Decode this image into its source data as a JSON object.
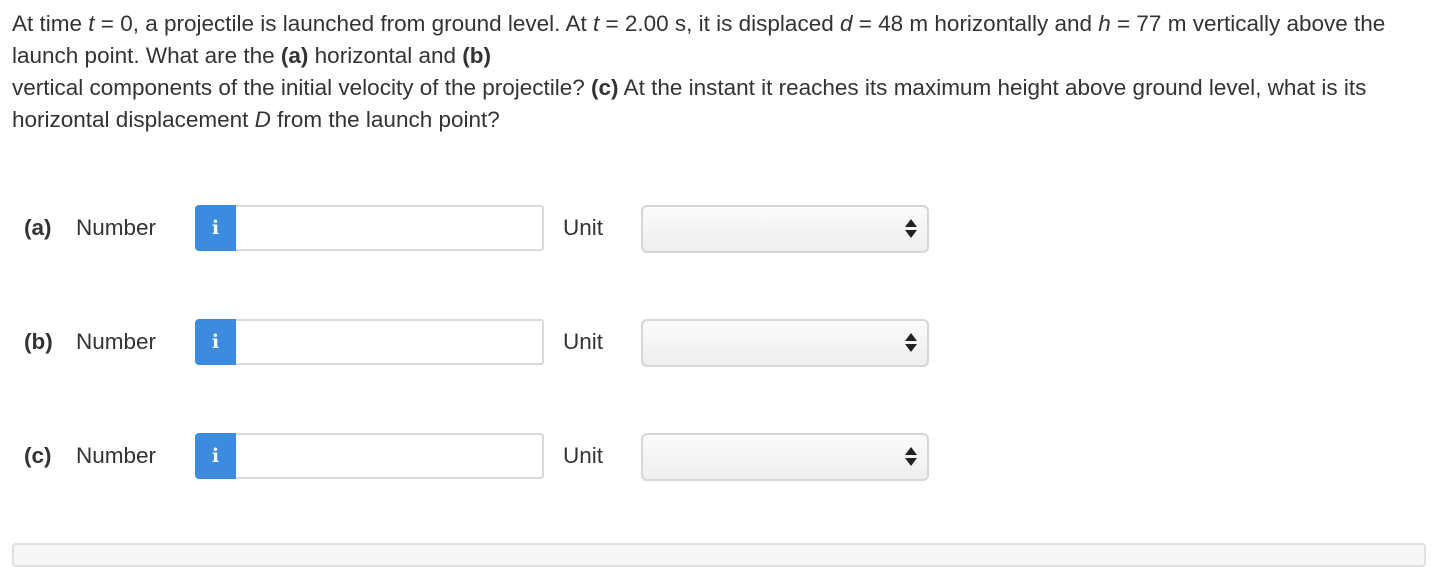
{
  "question": {
    "s1": "At time ",
    "t_var": "t",
    "s2": " = 0, a projectile is launched from ground level. At ",
    "t_var2": "t",
    "s3": " = 2.00 s, it is displaced ",
    "d_var": "d",
    "s4": " = 48 m horizontally and ",
    "h_var": "h",
    "s5": " = 77 m vertically above the launch point. What are the ",
    "part_a": "(a)",
    "s6": " horizontal and ",
    "part_b": "(b)",
    "s7": "vertical components of the initial velocity of the projectile? ",
    "part_c": "(c)",
    "s8": " At the instant it reaches its maximum height above ground level, what is its horizontal displacement ",
    "D_var": "D",
    "s9": " from the launch point?"
  },
  "rows": [
    {
      "part": "(a)",
      "number_label": "Number",
      "info_icon": "i",
      "value": "",
      "unit_label": "Unit",
      "unit_selected": ""
    },
    {
      "part": "(b)",
      "number_label": "Number",
      "info_icon": "i",
      "value": "",
      "unit_label": "Unit",
      "unit_selected": ""
    },
    {
      "part": "(c)",
      "number_label": "Number",
      "info_icon": "i",
      "value": "",
      "unit_label": "Unit",
      "unit_selected": ""
    }
  ],
  "colors": {
    "info_button": "#3d8bde",
    "text": "#333333"
  },
  "icons": {
    "info": "info-icon",
    "select_arrows": "up-down-arrows-icon"
  }
}
